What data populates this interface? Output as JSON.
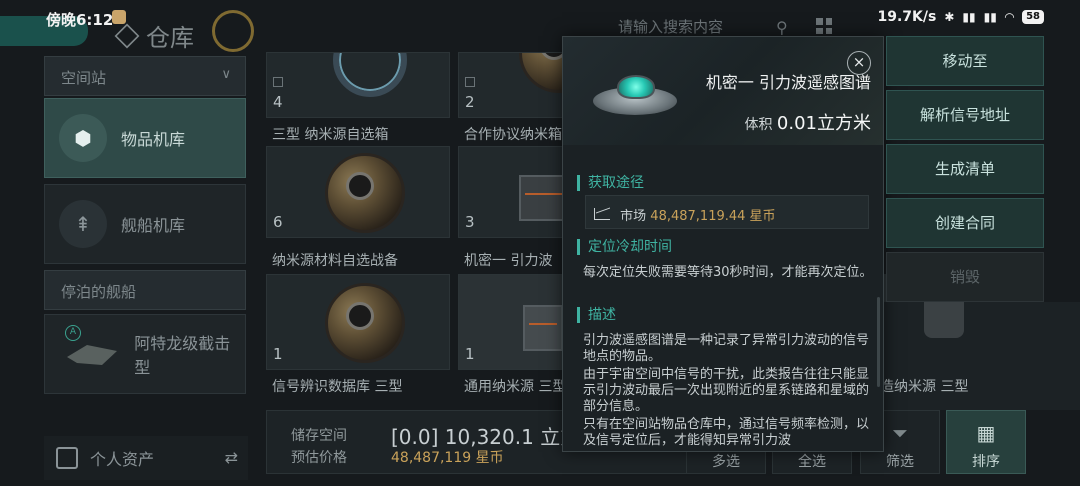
{
  "status": {
    "time": "傍晚6:12",
    "net_speed": "19.7K/s",
    "battery": "58"
  },
  "nav": {
    "title": "仓库",
    "search_placeholder": "请输入搜索内容"
  },
  "sidebar": {
    "section_station": "空间站",
    "item_goods": "物品机库",
    "item_ships": "舰船机库",
    "section_docked": "停泊的舰船",
    "docked_ship": "阿特龙级截击型",
    "docked_ship_level": "A",
    "personal_assets": "个人资产"
  },
  "grid": {
    "row1": [
      {
        "qty": "4",
        "name": "三型 纳米源自选箱"
      },
      {
        "qty": "2",
        "name": "合作协议纳米箱"
      }
    ],
    "row2": [
      {
        "qty": "6",
        "name": "纳米源材料自选战备"
      },
      {
        "qty": "3",
        "name": "机密一 引力波"
      }
    ],
    "row3": [
      {
        "qty": "1",
        "name": "信号辨识数据库 三型"
      },
      {
        "qty": "1",
        "name": "通用纳米源 三型"
      },
      {
        "qty": "",
        "name": "构造纳米源 三型"
      }
    ]
  },
  "bottom": {
    "storage_label": "储存空间",
    "storage_value": "[0.0] 10,320.1 立方",
    "value_label": "预估价格",
    "value_amount": "48,487,119 星币",
    "btn_multi": "多选",
    "btn_all": "全选",
    "btn_filter": "筛选",
    "btn_sort": "排序"
  },
  "popup": {
    "title": "机密一 引力波遥感图谱",
    "volume_label": "体积",
    "volume_value": "0.01立方米",
    "sec_source": "获取途径",
    "market_label": "市场",
    "market_price": "48,487,119.44 星币",
    "sec_cooldown": "定位冷却时间",
    "cooldown_text": "每次定位失败需要等待30秒时间，才能再次定位。",
    "sec_desc": "描述",
    "desc_1": "引力波遥感图谱是一种记录了异常引力波动的信号地点的物品。",
    "desc_2": "由于宇宙空间中信号的干扰，此类报告往往只能显示引力波动最后一次出现附近的星系链路和星域的部分信息。",
    "desc_3": "只有在空间站物品仓库中，通过信号频率检测，以及信号定位后，才能得知异常引力波"
  },
  "actions": {
    "move": "移动至",
    "parse": "解析信号地址",
    "list": "生成清单",
    "contract": "创建合同",
    "destroy": "销毁"
  },
  "colors": {
    "accent": "#3fb3a2",
    "price": "#c9a25a",
    "active_bg": "#2f4a48"
  }
}
